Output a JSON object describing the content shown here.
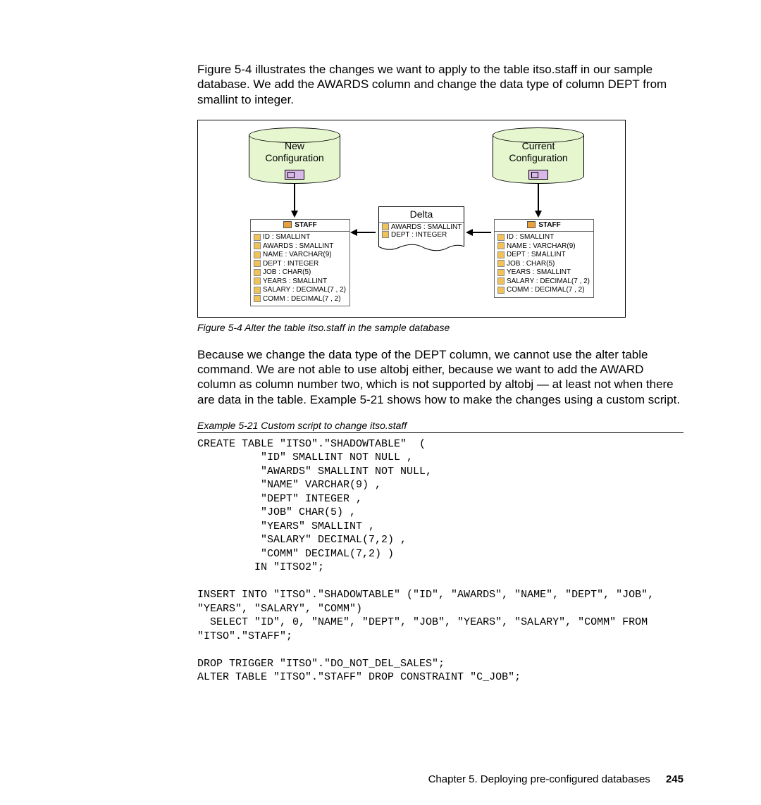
{
  "intro_paragraph": "Figure 5-4 illustrates the changes we want to apply to the table itso.staff in our sample database. We add the AWARDS column and change the data type of column DEPT from smallint to integer.",
  "figure": {
    "new_config_label": "New\nConfiguration",
    "current_config_label": "Current\nConfiguration",
    "delta_label": "Delta",
    "table_name": "STAFF",
    "new_columns": [
      "ID : SMALLINT",
      "AWARDS : SMALLINT",
      "NAME : VARCHAR(9)",
      "DEPT : INTEGER",
      "JOB : CHAR(5)",
      "YEARS : SMALLINT",
      "SALARY : DECIMAL(7 , 2)",
      "COMM : DECIMAL(7 , 2)"
    ],
    "delta_columns": [
      "AWARDS : SMALLINT",
      "DEPT : INTEGER"
    ],
    "current_columns": [
      "ID : SMALLINT",
      "NAME : VARCHAR(9)",
      "DEPT : SMALLINT",
      "JOB : CHAR(5)",
      "YEARS : SMALLINT",
      "SALARY : DECIMAL(7 , 2)",
      "COMM : DECIMAL(7 , 2)"
    ],
    "caption": "Figure 5-4   Alter the table itso.staff in the sample database"
  },
  "mid_paragraph": "Because we change the data type of the DEPT column, we cannot use the alter table command. We are not able to use altobj either, because we want to add the AWARD column as column number two, which is not supported by altobj — at least not when there are data in the table. Example 5-21 shows how to make the changes using a custom script.",
  "example": {
    "caption": "Example 5-21   Custom script to change itso.staff",
    "code": "CREATE TABLE \"ITSO\".\"SHADOWTABLE\"  (\n          \"ID\" SMALLINT NOT NULL ,\n          \"AWARDS\" SMALLINT NOT NULL,\n          \"NAME\" VARCHAR(9) ,\n          \"DEPT\" INTEGER ,\n          \"JOB\" CHAR(5) ,\n          \"YEARS\" SMALLINT ,\n          \"SALARY\" DECIMAL(7,2) ,\n          \"COMM\" DECIMAL(7,2) )\n         IN \"ITSO2\";\n\nINSERT INTO \"ITSO\".\"SHADOWTABLE\" (\"ID\", \"AWARDS\", \"NAME\", \"DEPT\", \"JOB\",\n\"YEARS\", \"SALARY\", \"COMM\")\n  SELECT \"ID\", 0, \"NAME\", \"DEPT\", \"JOB\", \"YEARS\", \"SALARY\", \"COMM\" FROM\n\"ITSO\".\"STAFF\";\n\nDROP TRIGGER \"ITSO\".\"DO_NOT_DEL_SALES\";\nALTER TABLE \"ITSO\".\"STAFF\" DROP CONSTRAINT \"C_JOB\";"
  },
  "footer": {
    "chapter": "Chapter 5. Deploying pre-configured databases",
    "page": "245"
  }
}
